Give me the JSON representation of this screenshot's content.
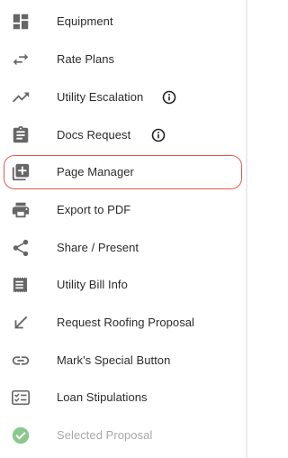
{
  "menu": {
    "items": [
      {
        "label": "Equipment",
        "icon": "dashboard-icon"
      },
      {
        "label": "Rate Plans",
        "icon": "swap-arrows-icon"
      },
      {
        "label": "Utility Escalation",
        "icon": "trending-up-icon",
        "info_icon": "info-icon"
      },
      {
        "label": "Docs Request",
        "icon": "clipboard-icon",
        "info_icon": "info-icon"
      },
      {
        "label": "Page Manager",
        "icon": "add-page-icon",
        "highlighted": true
      },
      {
        "label": "Export to PDF",
        "icon": "printer-icon"
      },
      {
        "label": "Share / Present",
        "icon": "share-icon"
      },
      {
        "label": "Utility Bill Info",
        "icon": "receipt-icon"
      },
      {
        "label": "Request Roofing Proposal",
        "icon": "arrow-down-left-icon"
      },
      {
        "label": "Mark's Special Button",
        "icon": "link-icon"
      },
      {
        "label": "Loan Stipulations",
        "icon": "checklist-icon"
      },
      {
        "label": "Selected Proposal",
        "icon": "check-circle-icon",
        "disabled": true
      }
    ]
  },
  "colors": {
    "icon": "#666666",
    "text": "#2b2b2b",
    "disabled_text": "#a8a8a8",
    "highlight_border": "#df5a4c",
    "check_green": "#8cc78f"
  }
}
